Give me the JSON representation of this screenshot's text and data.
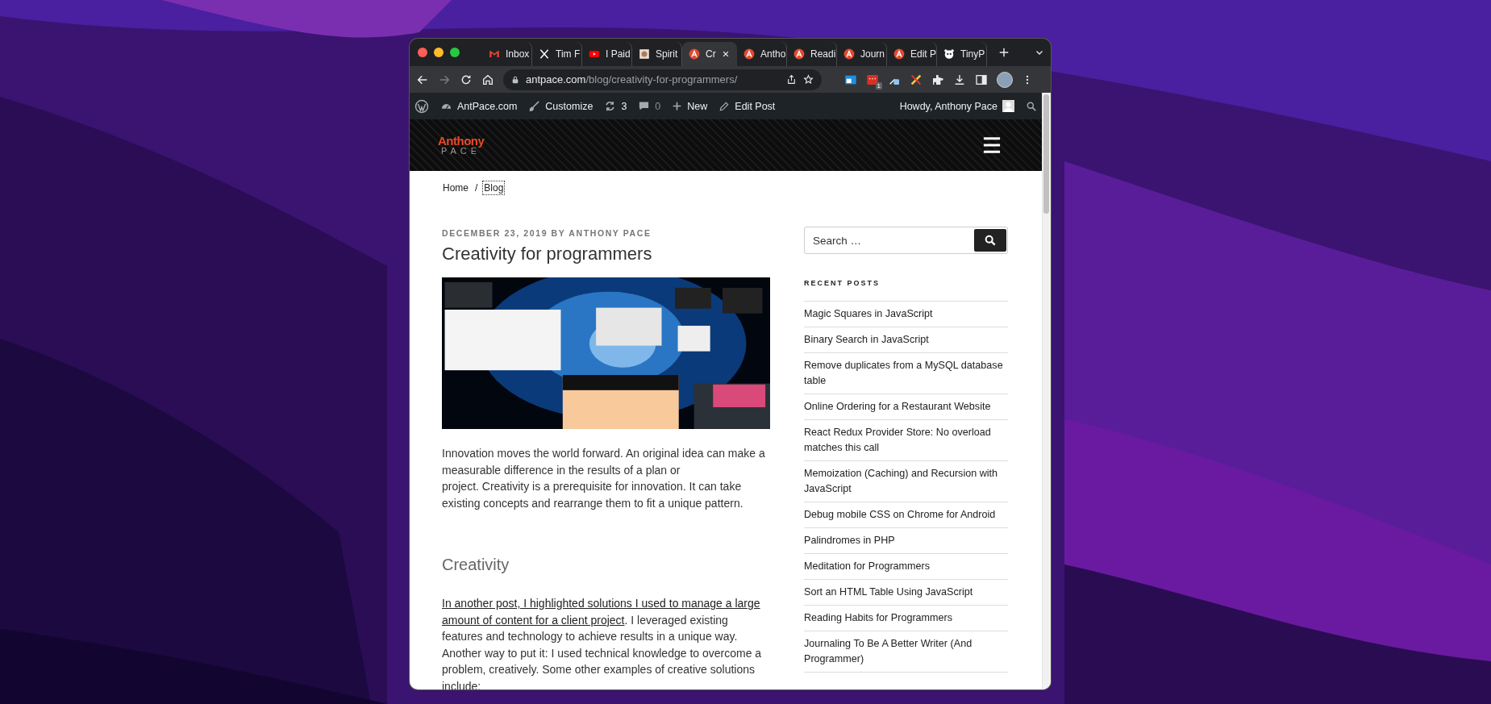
{
  "tabs": [
    {
      "label": "Inbox",
      "kind": "mail",
      "selected": false
    },
    {
      "label": "Tim F",
      "kind": "x",
      "selected": false
    },
    {
      "label": "I Paid",
      "kind": "video",
      "selected": false
    },
    {
      "label": "Spirit",
      "kind": "thumb",
      "selected": false
    },
    {
      "label": "Cr",
      "kind": "site",
      "selected": true
    },
    {
      "label": "Antho",
      "kind": "site",
      "selected": false
    },
    {
      "label": "Readi",
      "kind": "site",
      "selected": false
    },
    {
      "label": "Journ",
      "kind": "site",
      "selected": false
    },
    {
      "label": "Edit P",
      "kind": "site",
      "selected": false
    },
    {
      "label": "TinyP",
      "kind": "panda",
      "selected": false
    }
  ],
  "toolbar": {
    "url_host": "antpace.com",
    "url_path": "/blog/creativity-for-programmers/",
    "forward_disabled": true,
    "extension_badge": "1"
  },
  "admin_bar": {
    "site": "AntPace.com",
    "customize": "Customize",
    "updates": "3",
    "comments": "0",
    "new": "New",
    "edit": "Edit Post",
    "greeting": "Howdy, Anthony Pace"
  },
  "site_header": {
    "logo_top": "Anthony",
    "logo_bottom": "PACE"
  },
  "breadcrumb": {
    "separator": "/",
    "items": [
      {
        "label": "Home",
        "current": false
      },
      {
        "label": "Blog",
        "current": true
      }
    ]
  },
  "post": {
    "meta": "DECEMBER 23, 2019 BY ANTHONY PACE",
    "title": "Creativity for programmers",
    "blocks": [
      {
        "kind": "paragraph",
        "text": "Innovation moves the world forward. An original idea can make a measurable difference in the results of a plan or\nproject. Creativity is a prerequisite for innovation. It can take existing concepts and rearrange them to fit a unique pattern."
      },
      {
        "kind": "heading",
        "text": "Creativity"
      },
      {
        "kind": "paragraph",
        "link_lines": [
          "In another post, I highlighted solutions I used to manage a large",
          "amount of content for a client project"
        ],
        "text": ". I leveraged existing features and technology to achieve results in a unique way. Another way to put it: I used technical knowledge to overcome a problem, creatively. Some other examples of creative solutions include:"
      }
    ]
  },
  "sidebar": {
    "search": {
      "placeholder": "Search …"
    },
    "recent_posts": {
      "title": "RECENT POSTS",
      "items": [
        "Magic Squares in JavaScript",
        "Binary Search in JavaScript",
        "Remove duplicates from a MySQL database table",
        "Online Ordering for a Restaurant Website",
        "React Redux Provider Store: No overload matches this call",
        "Memoization (Caching) and Recursion with JavaScript",
        "Debug mobile CSS on Chrome for Android",
        "Palindromes in PHP",
        "Meditation for Programmers",
        "Sort an HTML Table Using JavaScript",
        "Reading Habits for Programmers",
        "Journaling To Be A Better Writer (And Programmer)"
      ]
    }
  }
}
